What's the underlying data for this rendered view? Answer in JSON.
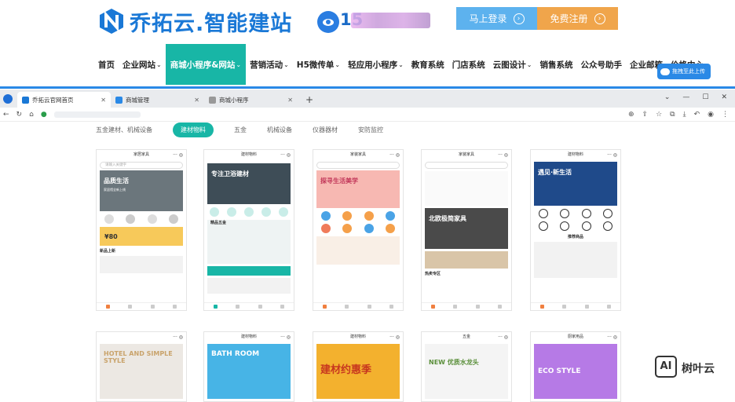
{
  "site": {
    "logo_text": "乔拓云.智能建站",
    "phone_visible": "15",
    "login_label": "马上登录",
    "register_label": "免费注册",
    "upload_label": "拖拽至此上传"
  },
  "nav": [
    {
      "label": "首页",
      "caret": ""
    },
    {
      "label": "企业网站",
      "caret": "⌄"
    },
    {
      "label": "商城小程序&网站",
      "caret": "⌄"
    },
    {
      "label": "营销活动",
      "caret": "⌄"
    },
    {
      "label": "H5微传单",
      "caret": "⌄"
    },
    {
      "label": "轻应用小程序",
      "caret": "⌄"
    },
    {
      "label": "教育系统",
      "caret": ""
    },
    {
      "label": "门店系统",
      "caret": ""
    },
    {
      "label": "云图设计",
      "caret": "⌄"
    },
    {
      "label": "销售系统",
      "caret": ""
    },
    {
      "label": "公众号助手",
      "caret": ""
    },
    {
      "label": "企业邮箱",
      "caret": ""
    },
    {
      "label": "价格中心",
      "caret": ""
    }
  ],
  "browser": {
    "tabs": [
      {
        "title": "乔拓云官网首页",
        "fav_color": "#1a78d6"
      },
      {
        "title": "商城管理",
        "fav_color": "#2a89e6"
      },
      {
        "title": "商城小程序",
        "fav_color": "#999999"
      }
    ],
    "new_tab": "+",
    "win_controls": [
      "⌄",
      "—",
      "☐",
      "✕"
    ]
  },
  "categories": [
    "五金建材、机械设备",
    "建材物料",
    "五金",
    "机械设备",
    "仪器器材",
    "安防监控"
  ],
  "active_category": "建材物料",
  "cards_row1": [
    {
      "header": "家居家具",
      "search": "请输入关键字",
      "banner_text": "品质生活",
      "banner_sub": "家居馆全新上线",
      "banner_color": "#5d6a70",
      "section": "新品上新",
      "price": "¥80"
    },
    {
      "header": "建材物料",
      "banner_text": "专注卫浴建材",
      "banner_color": "#3a4a55",
      "section": "精品五金",
      "price": ""
    },
    {
      "header": "家装家具",
      "banner_text": "探寻生活美学",
      "banner_color": "#f6b9b4",
      "section": "",
      "price": ""
    },
    {
      "header": "家装家具",
      "banner_text": "北欧极简家具",
      "banner_color": "#555555",
      "section": "热卖专区",
      "price": ""
    },
    {
      "header": "建材物料",
      "banner_text": "遇见·新生活",
      "banner_color": "#1f4a8a",
      "section": "推荐商品",
      "price": ""
    }
  ],
  "cards_row2": [
    {
      "header": "",
      "banner_text": "HOTEL AND SIMPLE STYLE",
      "banner_color": "#eae6e1"
    },
    {
      "header": "建材物料",
      "banner_text": "BATH ROOM",
      "banner_color": "#47b4e6"
    },
    {
      "header": "建材物料",
      "banner_text": "建材约惠季",
      "banner_color": "#f3b12e"
    },
    {
      "header": "五金",
      "banner_text": "NEW 优质水龙头",
      "banner_color": "#f7f7f7"
    },
    {
      "header": "厨家用品",
      "banner_text": "ECO STYLE",
      "banner_color": "#b67ae6"
    }
  ],
  "watermark": {
    "badge": "AI",
    "text": "树叶云"
  }
}
